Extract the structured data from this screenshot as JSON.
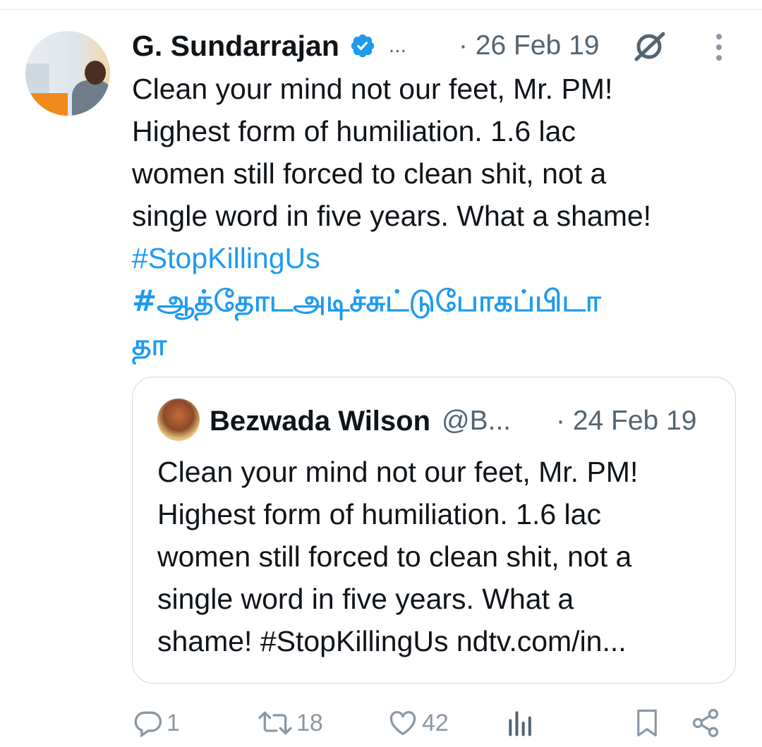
{
  "tweet": {
    "author_name": "G. Sundarrajan",
    "handle_truncated": "...",
    "timestamp": "· 26 Feb 19",
    "text_lines": [
      "Clean your mind not our feet, Mr. PM!",
      "Highest form of humiliation. 1.6 lac",
      "women still forced to clean shit, not a",
      "single word in five years. What a shame!"
    ],
    "hashtag_1": "#StopKillingUs",
    "hashtag_2_line1": "#ஆத்தோடஅடிச்சுட்டுபோகப்பிடா",
    "hashtag_2_line2": "தா"
  },
  "quoted_tweet": {
    "author_name": "Bezwada Wilson",
    "handle": "@B...",
    "timestamp": "· 24 Feb 19",
    "text_lines": [
      "Clean your mind not our feet, Mr. PM!",
      "Highest form of humiliation. 1.6 lac",
      "women still forced to clean shit, not a",
      "single word in five years. What a"
    ],
    "last_line_text": "shame! #StopKillingUs ndtv.com/in..."
  },
  "actions": {
    "replies": "1",
    "reposts": "18",
    "likes": "42"
  },
  "colors": {
    "link": "#1d9bf0",
    "secondary_text": "#536471",
    "verified": "#1d9bf0",
    "border": "#cfd9de"
  }
}
